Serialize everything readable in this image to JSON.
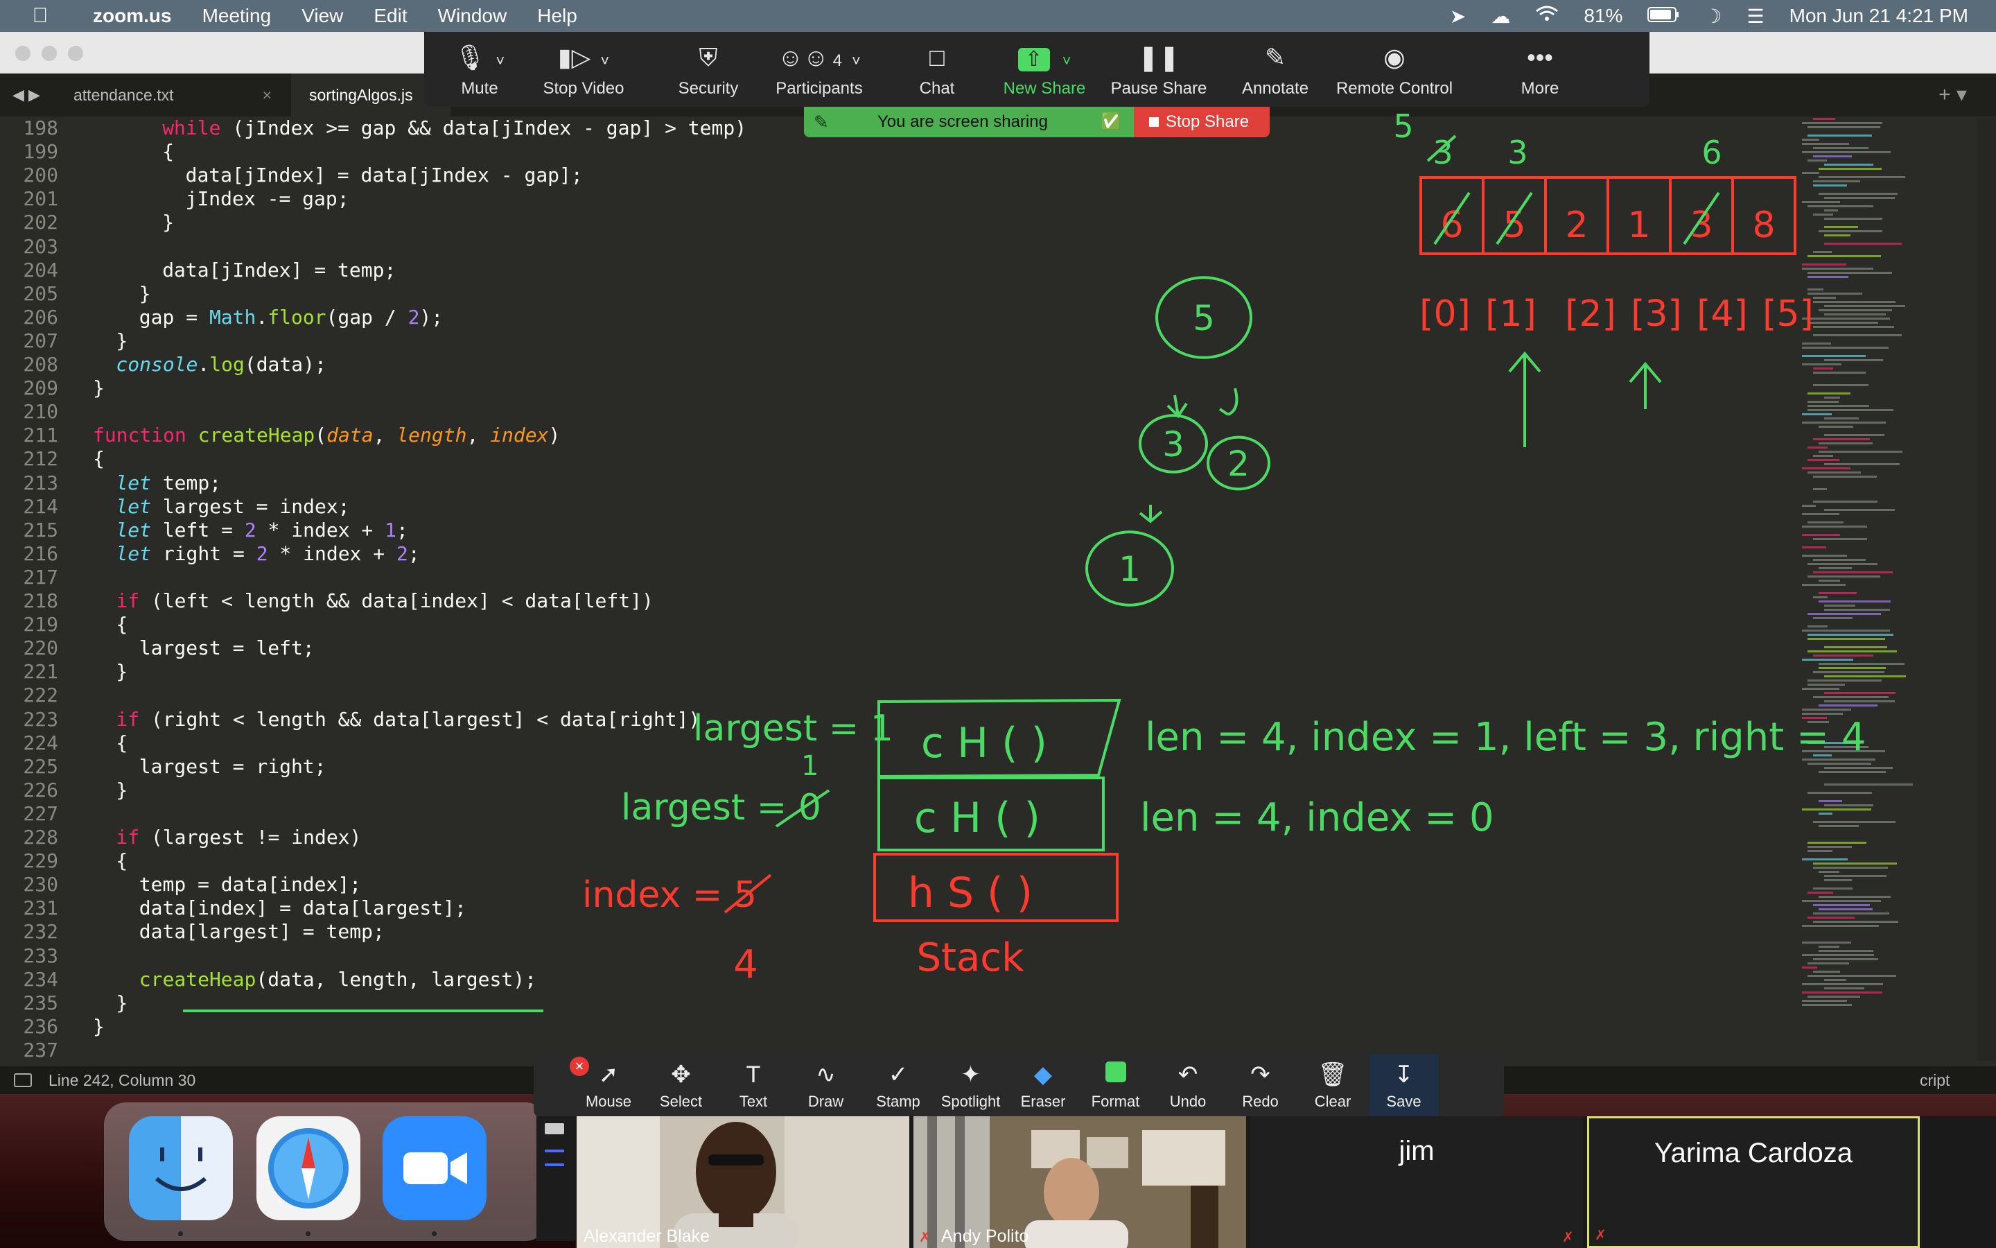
{
  "menubar": {
    "app": "zoom.us",
    "menus": [
      "Meeting",
      "View",
      "Edit",
      "Window",
      "Help"
    ],
    "battery": "81%",
    "datetime": "Mon Jun 21  4:21 PM",
    "icons": [
      "apple-icon",
      "location-icon",
      "cloud-icon",
      "wifi-icon",
      "battery-icon",
      "moon-icon",
      "control-center-icon"
    ]
  },
  "editor": {
    "tabs": [
      {
        "label": "attendance.txt",
        "active": false
      },
      {
        "label": "sortingAlgos.js",
        "active": true
      }
    ],
    "status": "Line 242, Column 30",
    "language_fragment": "cript"
  },
  "code_lines": [
    {
      "n": "198",
      "text": "while (jIndex >= gap && data[jIndex - gap] > temp)"
    },
    {
      "n": "199",
      "text": "{"
    },
    {
      "n": "200",
      "text": "data[jIndex] = data[jIndex - gap];"
    },
    {
      "n": "201",
      "text": "jIndex -= gap;"
    },
    {
      "n": "202",
      "text": "}"
    },
    {
      "n": "203",
      "text": ""
    },
    {
      "n": "204",
      "text": "data[jIndex] = temp;"
    },
    {
      "n": "205",
      "text": "}"
    },
    {
      "n": "206",
      "text": "gap = Math.floor(gap / 2);"
    },
    {
      "n": "207",
      "text": "}"
    },
    {
      "n": "208",
      "text": "console.log(data);"
    },
    {
      "n": "209",
      "text": "}"
    },
    {
      "n": "210",
      "text": ""
    },
    {
      "n": "211",
      "text": "function createHeap(data, length, index)"
    },
    {
      "n": "212",
      "text": "{"
    },
    {
      "n": "213",
      "text": "let temp;"
    },
    {
      "n": "214",
      "text": "let largest = index;"
    },
    {
      "n": "215",
      "text": "let left = 2 * index + 1;"
    },
    {
      "n": "216",
      "text": "let right = 2 * index + 2;"
    },
    {
      "n": "217",
      "text": ""
    },
    {
      "n": "218",
      "text": "if (left < length && data[index] < data[left])"
    },
    {
      "n": "219",
      "text": "{"
    },
    {
      "n": "220",
      "text": "largest = left;"
    },
    {
      "n": "221",
      "text": "}"
    },
    {
      "n": "222",
      "text": ""
    },
    {
      "n": "223",
      "text": "if (right < length && data[largest] < data[right])"
    },
    {
      "n": "224",
      "text": "{"
    },
    {
      "n": "225",
      "text": "largest = right;"
    },
    {
      "n": "226",
      "text": "}"
    },
    {
      "n": "227",
      "text": ""
    },
    {
      "n": "228",
      "text": "if (largest != index)"
    },
    {
      "n": "229",
      "text": "{"
    },
    {
      "n": "230",
      "text": "temp = data[index];"
    },
    {
      "n": "231",
      "text": "data[index] = data[largest];"
    },
    {
      "n": "232",
      "text": "data[largest] = temp;"
    },
    {
      "n": "233",
      "text": ""
    },
    {
      "n": "234",
      "text": "createHeap(data, length, largest);"
    },
    {
      "n": "235",
      "text": "}"
    },
    {
      "n": "236",
      "text": "}"
    },
    {
      "n": "237",
      "text": ""
    }
  ],
  "zoom_controls": [
    {
      "label": "Mute",
      "icon": "microphone-icon"
    },
    {
      "label": "Stop Video",
      "icon": "video-camera-icon"
    },
    {
      "label": "Security",
      "icon": "shield-icon"
    },
    {
      "label": "Participants",
      "icon": "participants-icon",
      "count": "4"
    },
    {
      "label": "Chat",
      "icon": "chat-icon"
    },
    {
      "label": "New Share",
      "icon": "share-screen-icon"
    },
    {
      "label": "Pause Share",
      "icon": "pause-icon"
    },
    {
      "label": "Annotate",
      "icon": "pencil-icon"
    },
    {
      "label": "Remote Control",
      "icon": "mouse-icon"
    },
    {
      "label": "More",
      "icon": "more-icon"
    }
  ],
  "share_banner": {
    "text": "You are screen sharing",
    "stop": "Stop Share"
  },
  "annotation_tools": [
    {
      "label": "Mouse",
      "icon": "cursor-icon"
    },
    {
      "label": "Select",
      "icon": "move-icon"
    },
    {
      "label": "Text",
      "icon": "text-icon"
    },
    {
      "label": "Draw",
      "icon": "draw-icon"
    },
    {
      "label": "Stamp",
      "icon": "checkmark-icon"
    },
    {
      "label": "Spotlight",
      "icon": "spotlight-icon"
    },
    {
      "label": "Eraser",
      "icon": "eraser-icon"
    },
    {
      "label": "Format",
      "icon": "format-icon"
    },
    {
      "label": "Undo",
      "icon": "undo-icon"
    },
    {
      "label": "Redo",
      "icon": "redo-icon"
    },
    {
      "label": "Clear",
      "icon": "trash-icon"
    },
    {
      "label": "Save",
      "icon": "save-icon"
    }
  ],
  "participants": [
    {
      "name": "Alexander Blake",
      "video": true
    },
    {
      "name": "Andy Polito",
      "video": true
    },
    {
      "name": "jim",
      "video": false
    },
    {
      "name": "Yarima Cardoza",
      "video": false
    }
  ],
  "annotations": {
    "array_counts": [
      "5",
      "3",
      "3",
      "6"
    ],
    "array_cells": [
      "6",
      "5",
      "2",
      "1",
      "3",
      "8"
    ],
    "array_indices": [
      "[0]",
      "[1]",
      "[2]",
      "[3]",
      "[4]",
      "[5]"
    ],
    "tree_nodes": [
      "5",
      "3",
      "2",
      "1"
    ],
    "largest_1": "largest = 1",
    "largest_1_below": "1",
    "largest_0": "largest = 0",
    "index_5": "index = 5",
    "index_4": "4",
    "stack_frames": [
      "c H ( )",
      "c H ( )",
      "h S ( )"
    ],
    "stack_label": "Stack",
    "call_1": "len = 4, index = 1, left = 3, right = 4",
    "call_2": "len = 4, index = 0",
    "colors": {
      "green": "#4cd964",
      "red": "#ff3b30"
    }
  }
}
